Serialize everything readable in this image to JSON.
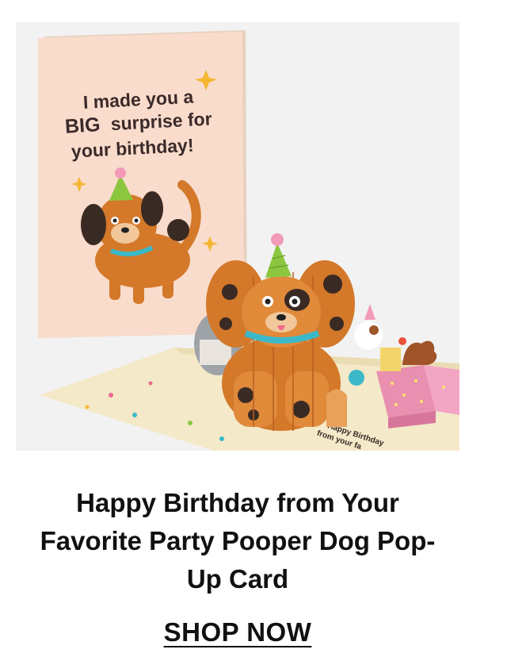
{
  "product": {
    "image_alt": "Happy Birthday from Your Favorite Party Pooper Dog Pop-Up Card",
    "card_text": {
      "line1": "I made you a",
      "big": "BIG",
      "line2_rest": "surprise for",
      "line3": "your birthday!"
    },
    "popup_inner_text": {
      "line1": "Happy Birthday",
      "line2": "from your fa"
    },
    "title": "Happy Birthday from Your Favorite Party Pooper Dog Pop-Up Card"
  },
  "cta": {
    "label": "SHOP NOW"
  },
  "colors": {
    "card_front": "#f8dcc8",
    "dog_orange": "#d4782a",
    "dog_spot": "#3a2a24",
    "collar": "#3cb9c8",
    "hat_green": "#8cc63f",
    "gift_pink": "#e98fb0",
    "base": "#f3e7c3"
  }
}
